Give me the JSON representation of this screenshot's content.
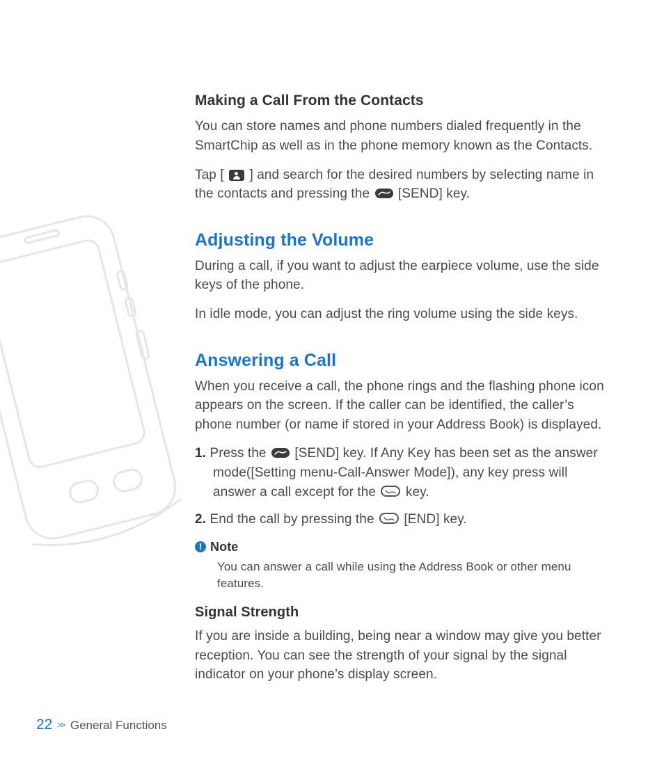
{
  "footer": {
    "page_number": "22",
    "chevrons": ">>",
    "section": "General Functions"
  },
  "s1": {
    "heading": "Making a Call From the Contacts",
    "p1": "You can store names and phone numbers dialed frequently in the SmartChip as well as in the phone memory known as the Contacts.",
    "p2a": "Tap [ ",
    "p2b": " ] and search for the desired numbers by selecting name in the con­tacts and pressing the ",
    "p2c": "[SEND] key."
  },
  "s2": {
    "heading": "Adjusting the Volume",
    "p1": "During a call, if you want to adjust the earpiece volume, use the side keys of the phone.",
    "p2": "In idle mode, you can adjust the ring volume using the side keys."
  },
  "s3": {
    "heading": "Answering a Call",
    "p1": "When you receive a call, the phone rings and the flashing phone icon appears on the screen. If the caller can be identified, the caller’s phone number (or name if stored in your Address Book) is displayed.",
    "li1_num": "1.",
    "li1a": " Press the ",
    "li1b": " [SEND] key. If Any Key has been set as the answer mode([Setting menu-Call-Answer Mode]), any key press will answer a call except for the ",
    "li1c": " key.",
    "li2_num": "2.",
    "li2a": " End the call by pressing the ",
    "li2b": " [END] key.",
    "note_label": "Note",
    "note_body": "You can answer a call while using the Address Book or other menu features."
  },
  "s4": {
    "heading": "Signal Strength",
    "p1": "If you are inside a building, being near a window may give you better reception. You can see the strength of your signal by the signal indicator on your phone’s display screen."
  }
}
